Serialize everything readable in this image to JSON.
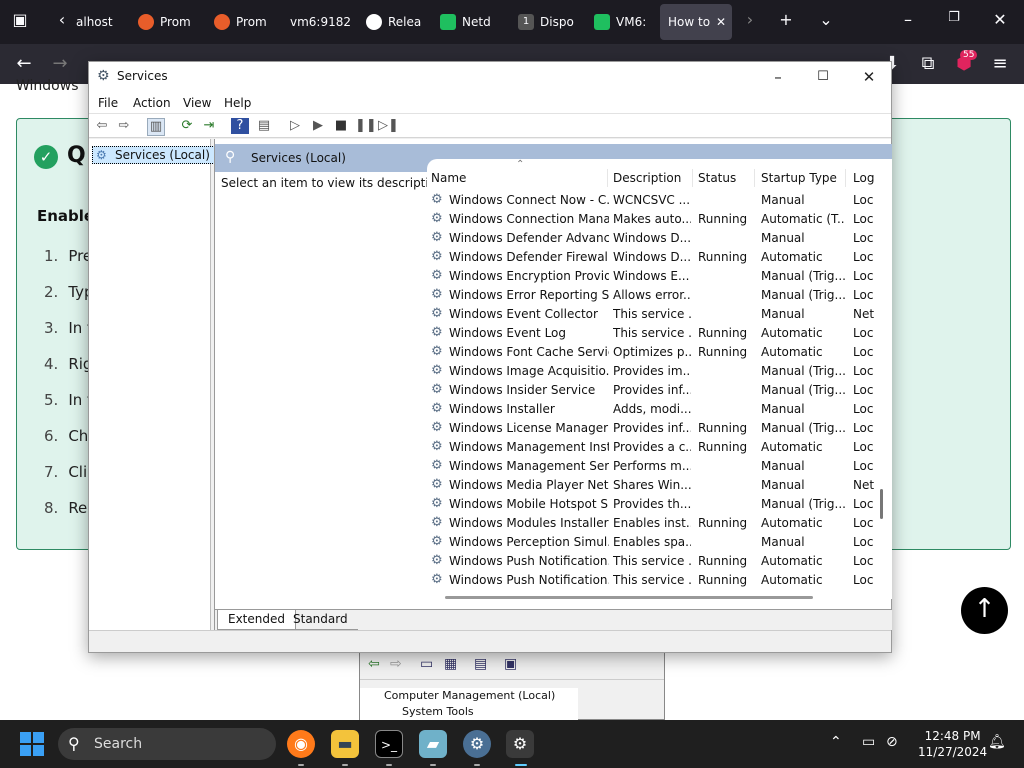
{
  "browser": {
    "tabs": [
      {
        "label": "alhost",
        "color": "#ffffff"
      },
      {
        "label": "Prom",
        "color": "#e85d2a"
      },
      {
        "label": "Prom",
        "color": "#e85d2a"
      },
      {
        "label": "vm6:9182",
        "color": ""
      },
      {
        "label": "Relea",
        "color": "#ffffff"
      },
      {
        "label": "Netd",
        "color": "#1fbf5f"
      },
      {
        "label": "Dispo",
        "color": "#333333",
        "badge": "1"
      },
      {
        "label": "VM6:",
        "color": "#1fbf5f"
      },
      {
        "label": "How to",
        "color": "",
        "active": true
      }
    ],
    "notification_count": "55"
  },
  "webpage": {
    "top_text": "Windows",
    "card_title": "Q",
    "card_subtitle": "Enable",
    "steps": [
      {
        "num": "1.",
        "text": "Pre"
      },
      {
        "num": "2.",
        "text": "Typ"
      },
      {
        "num": "3.",
        "text": "In t"
      },
      {
        "num": "4.",
        "text": "Rig"
      },
      {
        "num": "5.",
        "text": "In t"
      },
      {
        "num": "6.",
        "text": "Ch"
      },
      {
        "num": "7.",
        "text": "Cli"
      },
      {
        "num": "8.",
        "text": "Res"
      }
    ]
  },
  "services_window": {
    "title": "Services",
    "menu": [
      "File",
      "Action",
      "View",
      "Help"
    ],
    "tree_item": "Services (Local)",
    "header_title": "Services (Local)",
    "description_hint": "Select an item to view its description.",
    "columns": {
      "name": "Name",
      "description": "Description",
      "status": "Status",
      "startup": "Startup Type",
      "log": "Log"
    },
    "rows": [
      [
        "Windows Connect Now - C...",
        "WCNCSVC ...",
        "",
        "Manual",
        "Loc"
      ],
      [
        "Windows Connection Mana...",
        "Makes auto...",
        "Running",
        "Automatic (T...",
        "Loc"
      ],
      [
        "Windows Defender Advanc...",
        "Windows D...",
        "",
        "Manual",
        "Loc"
      ],
      [
        "Windows Defender Firewall",
        "Windows D...",
        "Running",
        "Automatic",
        "Loc"
      ],
      [
        "Windows Encryption Provid...",
        "Windows E...",
        "",
        "Manual (Trig...",
        "Loc"
      ],
      [
        "Windows Error Reporting Se...",
        "Allows error...",
        "",
        "Manual (Trig...",
        "Loc"
      ],
      [
        "Windows Event Collector",
        "This service ...",
        "",
        "Manual",
        "Net"
      ],
      [
        "Windows Event Log",
        "This service ...",
        "Running",
        "Automatic",
        "Loc"
      ],
      [
        "Windows Font Cache Service",
        "Optimizes p...",
        "Running",
        "Automatic",
        "Loc"
      ],
      [
        "Windows Image Acquisitio...",
        "Provides im...",
        "",
        "Manual (Trig...",
        "Loc"
      ],
      [
        "Windows Insider Service",
        "Provides inf...",
        "",
        "Manual (Trig...",
        "Loc"
      ],
      [
        "Windows Installer",
        "Adds, modi...",
        "",
        "Manual",
        "Loc"
      ],
      [
        "Windows License Manager ...",
        "Provides inf...",
        "Running",
        "Manual (Trig...",
        "Loc"
      ],
      [
        "Windows Management Inst...",
        "Provides a c...",
        "Running",
        "Automatic",
        "Loc"
      ],
      [
        "Windows Management Ser...",
        "Performs m...",
        "",
        "Manual",
        "Loc"
      ],
      [
        "Windows Media Player Net...",
        "Shares Win...",
        "",
        "Manual",
        "Net"
      ],
      [
        "Windows Mobile Hotspot S...",
        "Provides th...",
        "",
        "Manual (Trig...",
        "Loc"
      ],
      [
        "Windows Modules Installer",
        "Enables inst...",
        "Running",
        "Automatic",
        "Loc"
      ],
      [
        "Windows Perception Simul...",
        "Enables spa...",
        "",
        "Manual",
        "Loc"
      ],
      [
        "Windows Push Notification...",
        "This service ...",
        "Running",
        "Automatic",
        "Loc"
      ],
      [
        "Windows Push Notification...",
        "This service ...",
        "Running",
        "Automatic",
        "Loc"
      ]
    ],
    "view_tabs": {
      "extended": "Extended",
      "standard": "Standard"
    }
  },
  "computer_management": {
    "tree": [
      "Computer Management (Local)",
      "System Tools"
    ]
  },
  "taskbar": {
    "search_label": "Search",
    "time": "12:48 PM",
    "date": "11/27/2024"
  },
  "colors": {
    "accent": "#3aa0f5",
    "card_bg": "#dff3ec",
    "card_border": "#2e8a63",
    "header_blue": "#a8bcd8"
  }
}
